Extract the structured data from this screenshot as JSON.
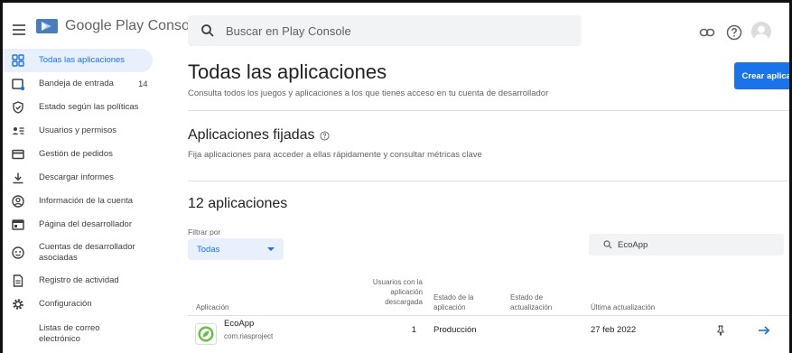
{
  "header": {
    "logo_text": "Google Play Console",
    "search_placeholder": "Buscar en Play Console"
  },
  "sidebar": {
    "items": [
      {
        "label": "Todas las aplicaciones",
        "active": true
      },
      {
        "label": "Bandeja de entrada",
        "count": "14"
      },
      {
        "label": "Estado según las políticas"
      },
      {
        "label": "Usuarios y permisos"
      },
      {
        "label": "Gestión de pedidos"
      },
      {
        "label": "Descargar informes"
      },
      {
        "label": "Información de la cuenta"
      },
      {
        "label": "Página del desarrollador"
      },
      {
        "label_line1": "Cuentas de desarrollador",
        "label_line2": "asociadas"
      },
      {
        "label": "Registro de actividad"
      },
      {
        "label": "Configuración"
      },
      {
        "label_line1": "Listas de correo",
        "label_line2": "electrónico"
      }
    ]
  },
  "main": {
    "title": "Todas las aplicaciones",
    "subtitle": "Consulta todos los juegos y aplicaciones a los que tienes acceso en tu cuenta de desarrollador",
    "create_button": "Crear aplicación",
    "pinned_title": "Aplicaciones fijadas",
    "pinned_subtitle": "Fija aplicaciones para acceder a ellas rápidamente y consultar métricas clave",
    "apps_count_title": "12 aplicaciones",
    "filter_label": "Filtrar por",
    "filter_value": "Todas",
    "app_search_value": "EcoApp",
    "table": {
      "columns": {
        "app": "Aplicación",
        "users_l1": "Usuarios con la",
        "users_l2": "aplicación",
        "users_l3": "descargada",
        "status_l1": "Estado de la",
        "status_l2": "aplicación",
        "update_l1": "Estado de",
        "update_l2": "actualización",
        "last_update": "Última actualización"
      },
      "rows": [
        {
          "name": "EcoApp",
          "package": "com.riasproject",
          "users": "1",
          "status": "Producción",
          "update_status": "",
          "last_update": "27 feb 2022"
        }
      ]
    }
  },
  "colors": {
    "accent": "#1a73e8",
    "active_bg": "#e8f0fe",
    "search_bg": "#f1f3f4"
  }
}
